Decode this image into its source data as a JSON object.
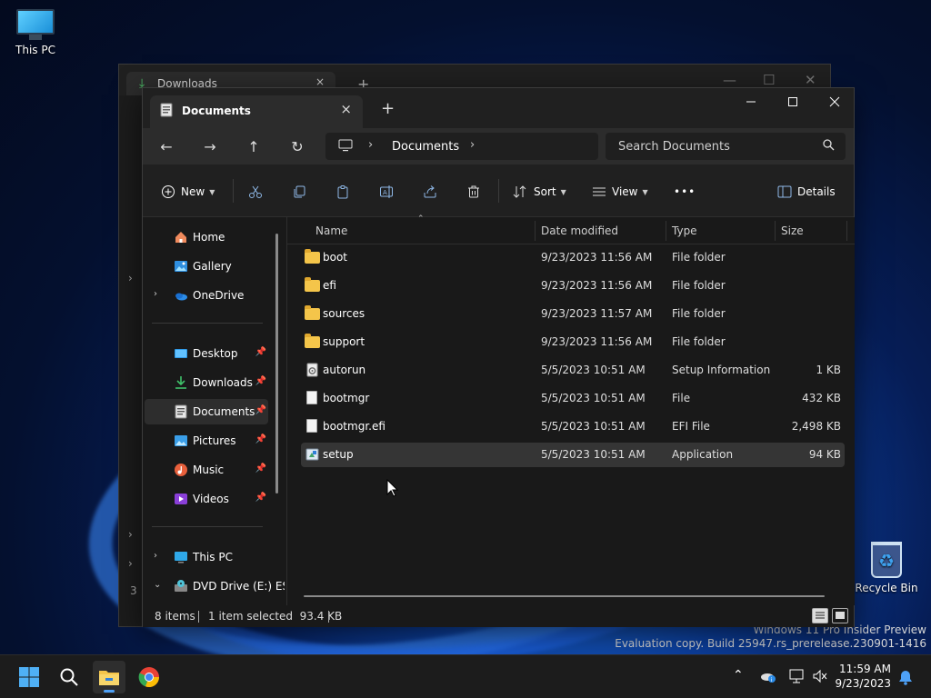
{
  "desktop": {
    "this_pc_label": "This PC",
    "recycle_bin_label": "Recycle Bin",
    "watermark_line1": "Windows 11 Pro Insider Preview",
    "watermark_line2": "Evaluation copy. Build 25947.rs_prerelease.230901-1416"
  },
  "background_window": {
    "tab_label": "Downloads"
  },
  "window": {
    "tab_label": "Documents",
    "close_tab": "×",
    "new_tab": "+",
    "minimize": "—",
    "maximize": "☐",
    "close": "✕"
  },
  "navbar": {
    "back": "←",
    "forward": "→",
    "up": "↑",
    "refresh": "↻",
    "breadcrumb": "Documents",
    "search_placeholder": "Search Documents"
  },
  "toolbar": {
    "new_label": "New",
    "sort_label": "Sort",
    "view_label": "View",
    "more_label": "•••",
    "details_label": "Details"
  },
  "sidebar": {
    "items": [
      {
        "label": "Home",
        "icon": "home-icon"
      },
      {
        "label": "Gallery",
        "icon": "gallery-icon"
      },
      {
        "label": "OneDrive",
        "icon": "onedrive-icon",
        "expander": "›"
      },
      {
        "label": "Desktop",
        "icon": "desktop-folder-icon",
        "pinned": true
      },
      {
        "label": "Downloads",
        "icon": "downloads-folder-icon",
        "pinned": true
      },
      {
        "label": "Documents",
        "icon": "documents-folder-icon",
        "pinned": true,
        "selected": true
      },
      {
        "label": "Pictures",
        "icon": "pictures-folder-icon",
        "pinned": true
      },
      {
        "label": "Music",
        "icon": "music-folder-icon",
        "pinned": true
      },
      {
        "label": "Videos",
        "icon": "videos-folder-icon",
        "pinned": true
      },
      {
        "label": "This PC",
        "icon": "this-pc-icon",
        "expander": "›"
      },
      {
        "label": "DVD Drive (E:) ES",
        "icon": "dvd-drive-icon",
        "expander": "⌄"
      }
    ]
  },
  "columns": {
    "name": "Name",
    "date": "Date modified",
    "type": "Type",
    "size": "Size"
  },
  "files": [
    {
      "name": "boot",
      "date": "9/23/2023 11:56 AM",
      "type": "File folder",
      "size": "",
      "icon": "folder-icon"
    },
    {
      "name": "efi",
      "date": "9/23/2023 11:56 AM",
      "type": "File folder",
      "size": "",
      "icon": "folder-icon"
    },
    {
      "name": "sources",
      "date": "9/23/2023 11:57 AM",
      "type": "File folder",
      "size": "",
      "icon": "folder-icon"
    },
    {
      "name": "support",
      "date": "9/23/2023 11:56 AM",
      "type": "File folder",
      "size": "",
      "icon": "folder-icon"
    },
    {
      "name": "autorun",
      "date": "5/5/2023 10:51 AM",
      "type": "Setup Information",
      "size": "1 KB",
      "icon": "setup-info-icon"
    },
    {
      "name": "bootmgr",
      "date": "5/5/2023 10:51 AM",
      "type": "File",
      "size": "432 KB",
      "icon": "file-icon"
    },
    {
      "name": "bootmgr.efi",
      "date": "5/5/2023 10:51 AM",
      "type": "EFI File",
      "size": "2,498 KB",
      "icon": "file-icon"
    },
    {
      "name": "setup",
      "date": "5/5/2023 10:51 AM",
      "type": "Application",
      "size": "94 KB",
      "icon": "application-icon",
      "selected": true
    }
  ],
  "status": {
    "count": "8 items",
    "selection": "1 item selected  93.4 KB"
  },
  "taskbar": {
    "time": "11:59 AM",
    "date": "9/23/2023"
  },
  "colors": {
    "accent": "#4ea1f7",
    "window_bg": "#191919",
    "folder": "#f4c54a"
  }
}
